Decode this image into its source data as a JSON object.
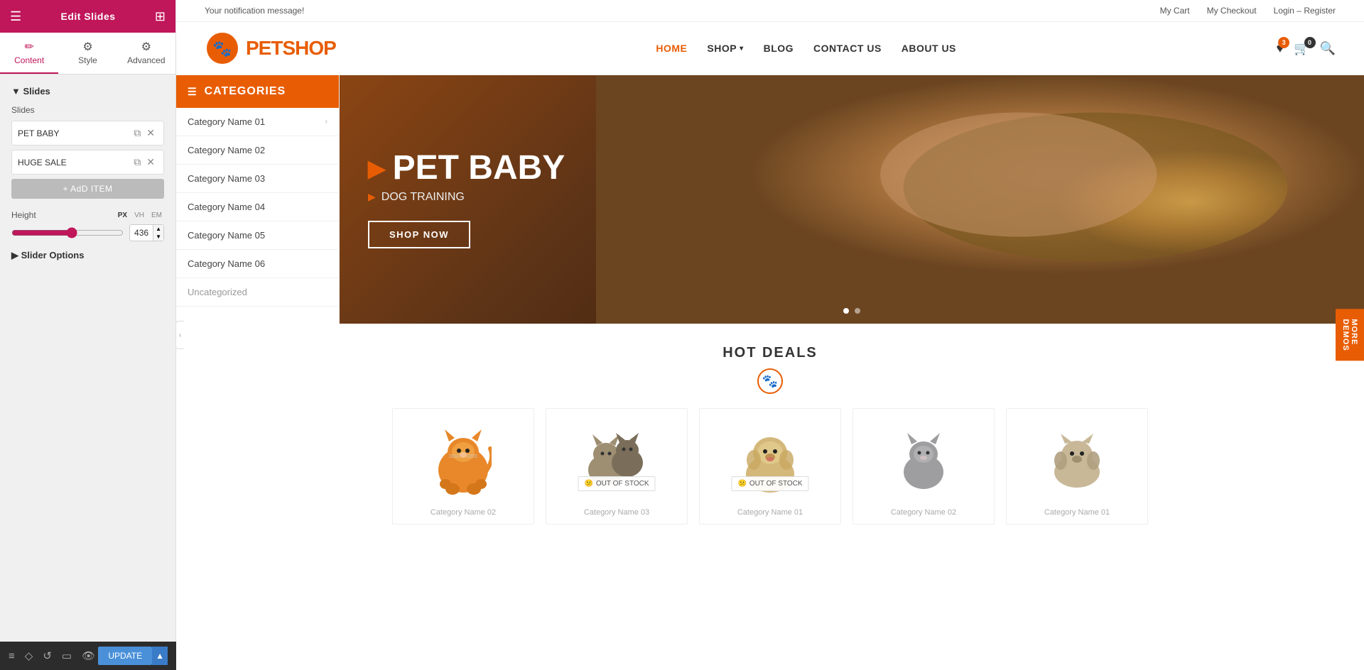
{
  "panel": {
    "title": "Edit Slides",
    "tabs": [
      {
        "id": "content",
        "label": "Content",
        "icon": "✏️",
        "active": true
      },
      {
        "id": "style",
        "label": "Style",
        "icon": "⚙️",
        "active": false
      },
      {
        "id": "advanced",
        "label": "Advanced",
        "icon": "⚙️",
        "active": false
      }
    ],
    "section_slides_label": "▼ Slides",
    "slides_sublabel": "Slides",
    "slide_items": [
      {
        "id": 1,
        "label": "PET BABY"
      },
      {
        "id": 2,
        "label": "HUGE SALE"
      }
    ],
    "add_item_label": "+ AdD ITEM",
    "height_label": "Height",
    "height_units": [
      "PX",
      "VH",
      "EM"
    ],
    "height_active_unit": "PX",
    "height_value": "436",
    "slider_options_label": "▶ Slider Options"
  },
  "toolbar": {
    "update_label": "UPDATE",
    "icons": [
      "☰",
      "⬡",
      "↺",
      "▭",
      "👁"
    ]
  },
  "notif": {
    "message": "Your notification message!",
    "links": [
      "My Cart",
      "My Checkout",
      "Login – Register"
    ]
  },
  "site": {
    "logo_text_pre": "PET",
    "logo_text_post": "SHOP",
    "nav_items": [
      {
        "label": "HOME",
        "active": true,
        "has_arrow": false
      },
      {
        "label": "SHOP",
        "active": false,
        "has_arrow": true
      },
      {
        "label": "BLOG",
        "active": false,
        "has_arrow": false
      },
      {
        "label": "CONTACT US",
        "active": false,
        "has_arrow": false
      },
      {
        "label": "ABOUT US",
        "active": false,
        "has_arrow": false
      }
    ],
    "wishlist_count": "3",
    "cart_count": "0"
  },
  "categories": {
    "header": "CATEGORIES",
    "items": [
      {
        "label": "Category Name 01",
        "has_arrow": true
      },
      {
        "label": "Category Name 02",
        "has_arrow": false
      },
      {
        "label": "Category Name 03",
        "has_arrow": false
      },
      {
        "label": "Category Name 04",
        "has_arrow": false
      },
      {
        "label": "Category Name 05",
        "has_arrow": false
      },
      {
        "label": "Category Name 06",
        "has_arrow": false
      },
      {
        "label": "Uncategorized",
        "has_arrow": false,
        "muted": true
      }
    ]
  },
  "hero": {
    "title": "PET BABY",
    "subtitle": "DOG TRAINING",
    "cta_label": "SHOP NOW"
  },
  "hot_deals": {
    "title": "HOT DEALS",
    "products": [
      {
        "id": 1,
        "category": "Category Name 02",
        "out_of_stock": false,
        "animal": "orange-cat"
      },
      {
        "id": 2,
        "category": "Category Name 03",
        "out_of_stock": true,
        "animal": "tabby-cats"
      },
      {
        "id": 3,
        "category": "Category Name 01",
        "out_of_stock": true,
        "animal": "golden-puppy"
      },
      {
        "id": 4,
        "category": "Category Name 02",
        "out_of_stock": false,
        "animal": "grey-cat"
      },
      {
        "id": 5,
        "category": "Category Name 01",
        "out_of_stock": false,
        "animal": "small-dog"
      }
    ],
    "out_of_stock_label": "OUT OF STOCK"
  },
  "more_demos": {
    "label": "MORE\nDEMOS"
  }
}
